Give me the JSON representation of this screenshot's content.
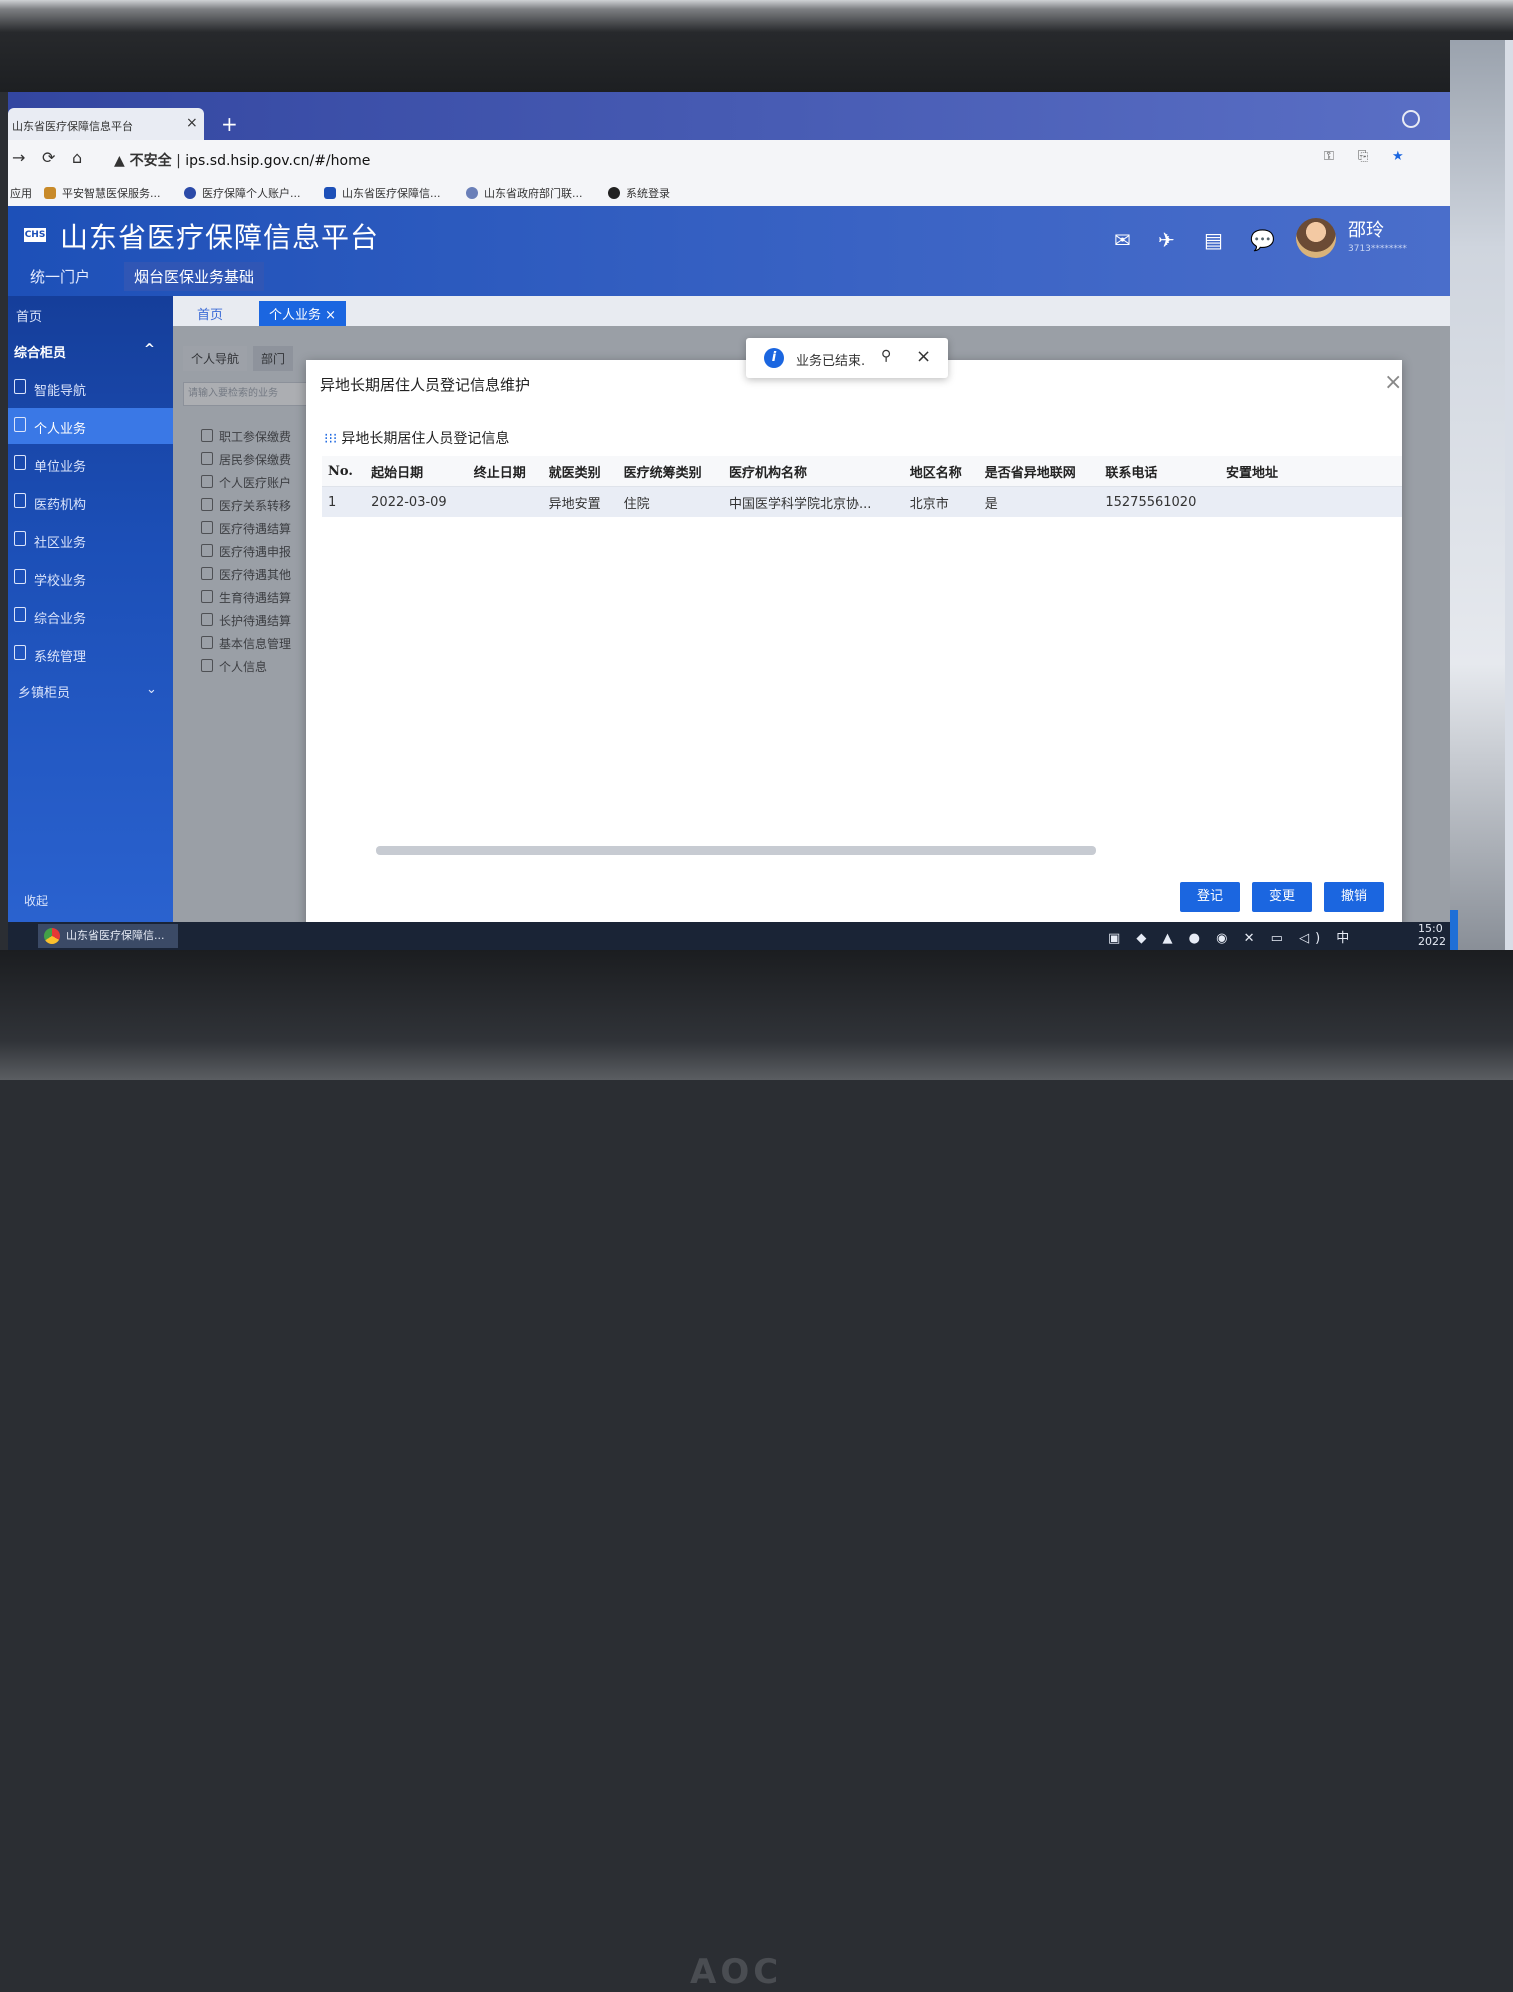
{
  "browser": {
    "tab_title": "山东省医疗保障信息平台",
    "tab_close": "×",
    "new_tab": "+",
    "security_label": "▲ 不安全",
    "url": "ips.sd.hsip.gov.cn/#/home",
    "bookmarks": [
      "应用",
      "平安智慧医保服务...",
      "医疗保障个人账户...",
      "山东省医疗保障信...",
      "山东省政府部门联...",
      "系统登录"
    ]
  },
  "app": {
    "logo_text": "CHS",
    "title": "山东省医疗保障信息平台",
    "top_nav": [
      "统一门户",
      "烟台医保业务基础"
    ],
    "user_name": "邵玲",
    "user_sub": "3713********"
  },
  "sidebar": {
    "home": "首页",
    "group": "综合柜员",
    "items": [
      {
        "label": "智能导航"
      },
      {
        "label": "个人业务"
      },
      {
        "label": "单位业务"
      },
      {
        "label": "医药机构"
      },
      {
        "label": "社区业务"
      },
      {
        "label": "学校业务"
      },
      {
        "label": "综合业务"
      },
      {
        "label": "系统管理"
      }
    ],
    "group2": "乡镇柜员",
    "collapse": "收起"
  },
  "main": {
    "crumb_home": "首页",
    "crumb_active": "个人业务 ×",
    "subtabs": [
      "个人导航",
      "部门"
    ],
    "search_placeholder": "请输入要检索的业务",
    "tree": [
      "职工参保缴费",
      "居民参保缴费",
      "个人医疗账户",
      "医疗关系转移",
      "医疗待遇结算",
      "医疗待遇申报",
      "医疗待遇其他",
      "生育待遇结算",
      "长护待遇结算",
      "基本信息管理",
      "个人信息"
    ]
  },
  "toast": {
    "message": "业务已结束.",
    "info": "i",
    "pin": "⚲",
    "close": "×"
  },
  "dialog": {
    "title": "异地长期居住人员登记信息维护",
    "close": "×",
    "section_title": "异地长期居住人员登记信息",
    "section_icon": "⁝⁝⁝",
    "columns": [
      "No.",
      "起始日期",
      "终止日期",
      "就医类别",
      "医疗统筹类别",
      "医疗机构名称",
      "地区名称",
      "是否省异地联网",
      "联系电话",
      "安置地址"
    ],
    "rows": [
      [
        "1",
        "2022-03-09",
        "",
        "异地安置",
        "住院",
        "中国医学科学院北京协...",
        "北京市",
        "是",
        "15275561020",
        ""
      ]
    ],
    "buttons": [
      "登记",
      "变更",
      "撤销"
    ]
  },
  "taskbar": {
    "app_label": "山东省医疗保障信...",
    "tray": "中",
    "time": "15:0",
    "date": "2022"
  },
  "monitor_brand": "AOC"
}
